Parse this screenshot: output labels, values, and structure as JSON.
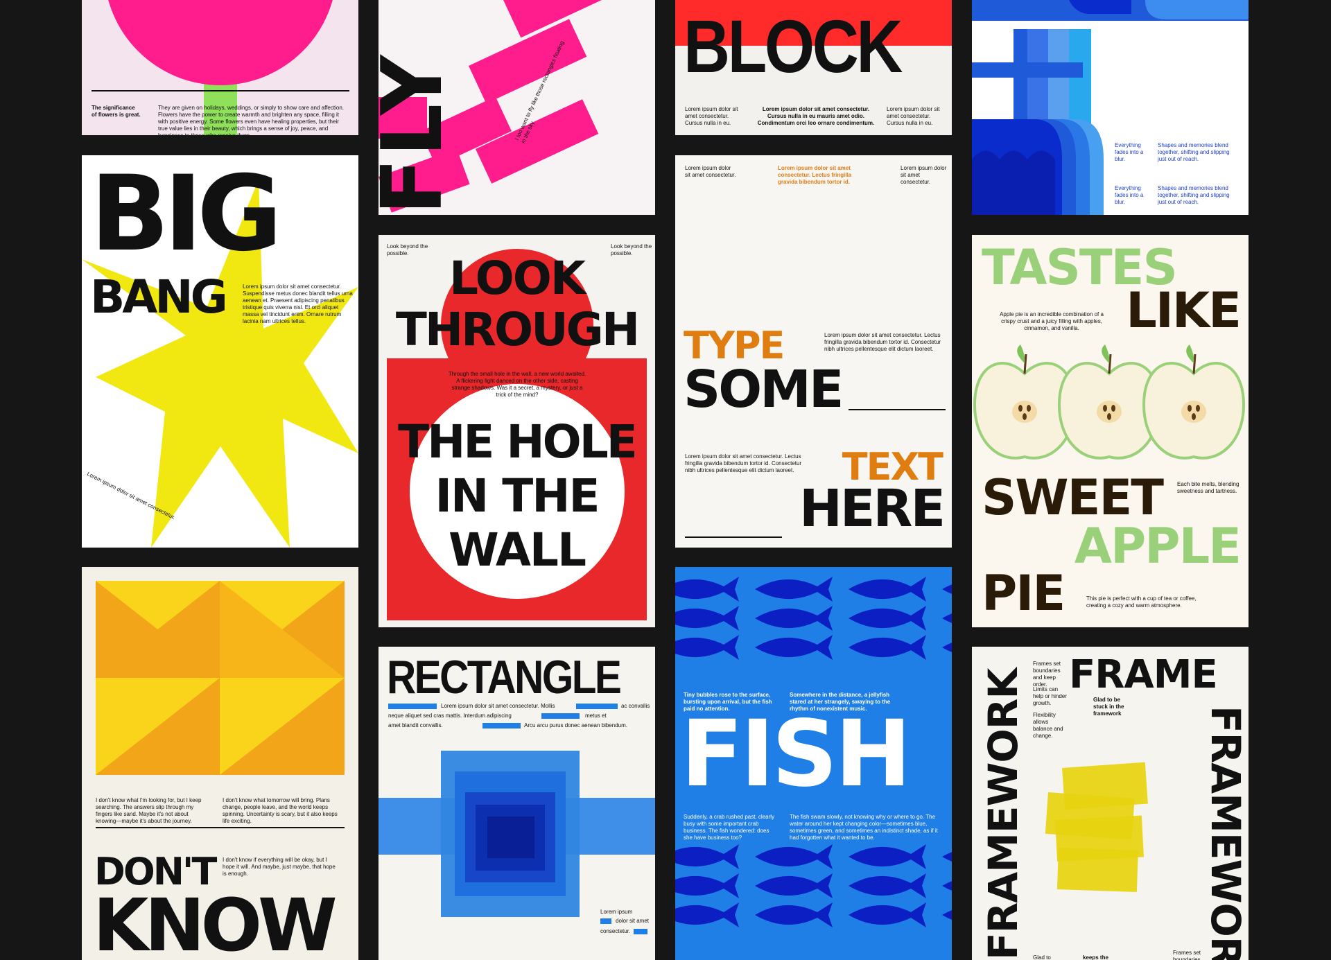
{
  "colors": {
    "background": "#161616",
    "pink": "#ff1d8e",
    "red": "#e8282b",
    "yellow": "#f1e812",
    "blue": "#1f7fe6",
    "orange": "#e07d10",
    "green": "#9bd07a"
  },
  "flowers": {
    "caption_title": "The significance of flowers is great.",
    "caption_body": "They are given on holidays, weddings, or simply to show care and affection. Flowers have the power to create warmth and brighten any space, filling it with positive energy. Some flowers even have healing properties, but their true value lies in their beauty, which brings a sense of joy, peace, and happiness to those who receive them."
  },
  "fly": {
    "word": "FLY",
    "caption": "I too want to fly like those rectangles floating in the sky"
  },
  "block": {
    "word": "BLOCK",
    "col1": "Lorem ipsum dolor sit amet consectetur. Cursus nulla in eu.",
    "col2": "Lorem ipsum dolor sit amet consectetur. Cursus nulla in eu mauris amet odio. Condimentum orci leo ornare condimentum.",
    "col3": "Lorem ipsum dolor sit amet consectetur. Cursus nulla in eu."
  },
  "blur": {
    "text1": "Everything fades into a blur.",
    "text2": "Shapes and memories blend together, shifting and slipping just out of reach.",
    "text3": "Everything fades into a blur.",
    "text4": "Shapes and memories blend together, shifting and slipping just out of reach."
  },
  "big_bang": {
    "line1": "BIG",
    "line2": "BANG",
    "body": "Lorem ipsum dolor sit amet consectetur. Suspendisse metus donec blandit tellus urna aenean et. Praesent adipiscing penatibus tristique quis viverra nisl. Et orci aliquet massa vel tincidunt enim. Ornare rutrum lacinia nam ultrices tellus.",
    "rotated": "Lorem ipsum dolor sit amet consectetur."
  },
  "look": {
    "corner_left": "Look beyond the possible.",
    "corner_right": "Look beyond the possible.",
    "line1": "LOOK",
    "line2": "THROUGH",
    "body": "Through the small hole in the wall, a new world awaited. A flickering light danced on the other side, casting strange shadows. Was it a secret, a mystery, or just a trick of the mind?",
    "line3": "THE HOLE",
    "line4": "IN THE",
    "line5": "WALL"
  },
  "type_some": {
    "top_left": "Lorem ipsum dolor sit amet consectetur.",
    "top_center": "Lorem ipsum dolor sit amet consectetur. Lectus fringilla gravida bibendum tortor id.",
    "top_right": "Lorem ipsum dolor sit amet consectetur.",
    "mid_right": "Lorem ipsum dolor sit amet consectetur. Lectus fringilla gravida bibendum tortor id. Consectetur nibh ultrices pellentesque elit dictum laoreet.",
    "word1": "TYPE",
    "word2": "SOME",
    "bottom_left": "Lorem ipsum dolor sit amet consectetur. Lectus fringilla gravida bibendum tortor id. Consectetur nibh ultrices pellentesque elit dictum laoreet.",
    "word3": "TEXT",
    "word4": "HERE"
  },
  "tastes": {
    "word1": "TASTES",
    "word2": "LIKE",
    "intro": "Apple pie is an incredible combination of a crispy crust and a juicy filling with apples, cinnamon, and vanilla.",
    "word3": "SWEET",
    "side": "Each bite melts, blending sweetness and tartness.",
    "word4": "APPLE",
    "word5": "PIE",
    "outro": "This pie is perfect with a cup of tea or coffee, creating a cozy and warm atmosphere."
  },
  "dont_know": {
    "col1": "I don't know what I'm looking for, but I keep searching. The answers slip through my fingers like sand. Maybe it's not about knowing—maybe it's about the journey.",
    "col2": "I don't know what tomorrow will bring. Plans change, people leave, and the world keeps spinning. Uncertainty is scary, but it also keeps life exciting.",
    "line1": "DON'T",
    "line2": "KNOW",
    "side": "I don't know if everything will be okay, but I hope it will. And maybe, just maybe, that hope is enough."
  },
  "rectangle": {
    "word": "RECTANGLE",
    "text1": "Lorem ipsum dolor sit amet consectetur. Mollis",
    "text2": "ac convallis",
    "text3": "neque aliquet sed cras mattis. Interdum adipiscing",
    "text4": "metus et",
    "text5": "amet blandit convallis.",
    "text6": "Arcu arcu purus donec aenean bibendum.",
    "foot1": "Lorem ipsum",
    "foot2": "dolor sit amet",
    "foot3": "consectetur."
  },
  "fish": {
    "text1": "Tiny bubbles rose to the surface, bursting upon arrival, but the fish paid no attention.",
    "text2": "Somewhere in the distance, a jellyfish stared at her strangely, swaying to the rhythm of nonexistent music.",
    "word": "FISH",
    "text3": "Suddenly, a crab rushed past, clearly busy with some important crab business. The fish wondered: does she have business too?",
    "text4": "The fish swam slowly, not knowing why or where to go. The water around her kept changing color—sometimes blue, sometimes green, and sometimes an indistinct shade, as if it had forgotten what it wanted to be."
  },
  "frame": {
    "word1": "FRAME",
    "word2": "FRAMEWORK",
    "word3": "FRAMEWORK",
    "text1": "Frames set boundaries and keep order.",
    "text2": "Limits can help or hinder growth.",
    "text3": "Flexibility allows balance and change.",
    "text4": "Glad to be stuck in the framework",
    "foot1": "Glad to",
    "foot2": "keeps the",
    "foot3": "Frames set boundaries"
  }
}
